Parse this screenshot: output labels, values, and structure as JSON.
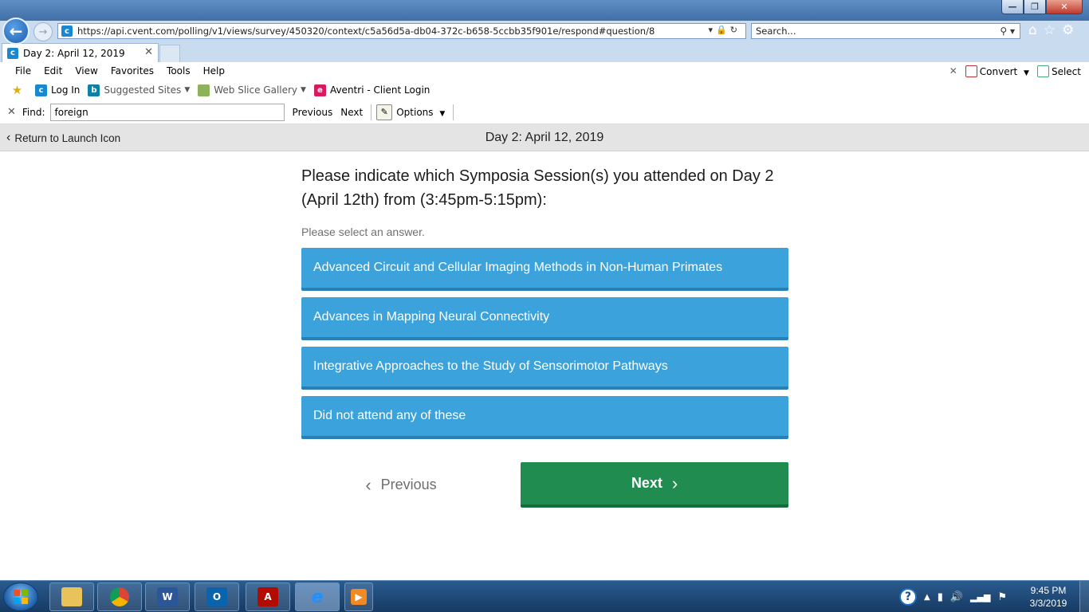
{
  "browser": {
    "address_url": "https://api.cvent.com/polling/v1/views/survey/450320/context/c5a56d5a-db04-372c-b658-5ccbb35f901e/respond#question/8",
    "search_placeholder": "Search...",
    "tab_title": "Day 2: April 12, 2019",
    "menu": [
      "File",
      "Edit",
      "View",
      "Favorites",
      "Tools",
      "Help"
    ],
    "convert_label": "Convert",
    "select_label": "Select",
    "favorites": {
      "login": "Log In",
      "suggested": "Suggested Sites",
      "webslice": "Web Slice Gallery",
      "aventri": "Aventri - Client Login"
    },
    "find": {
      "label": "Find:",
      "value": "foreign",
      "previous": "Previous",
      "next": "Next",
      "options": "Options"
    }
  },
  "page": {
    "return_label": "Return to Launch Icon",
    "title": "Day 2: April 12, 2019",
    "question": "Please indicate which Symposia Session(s) you attended on Day 2 (April 12th) from (3:45pm-5:15pm):",
    "instruction": "Please select an answer.",
    "answers": [
      "Advanced Circuit and Cellular Imaging Methods in Non-Human Primates",
      "Advances in Mapping Neural Connectivity",
      "Integrative Approaches to the Study of Sensorimotor Pathways",
      "Did not attend any of these"
    ],
    "prev_label": "Previous",
    "next_label": "Next"
  },
  "taskbar": {
    "time": "9:45 PM",
    "date": "3/3/2019"
  },
  "colors": {
    "answer_bg": "#3ba2dc",
    "next_bg": "#218c4f",
    "header_bar": "#e4e4e4"
  }
}
